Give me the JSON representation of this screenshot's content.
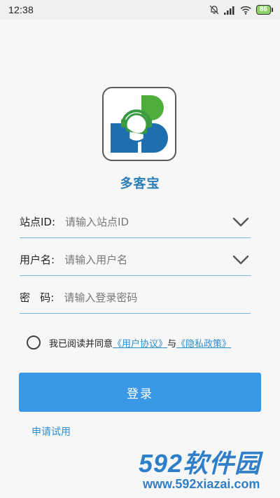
{
  "status_bar": {
    "time": "12:38",
    "battery": "86",
    "icons": [
      "mute-icon",
      "signal-icon",
      "wifi-icon",
      "battery-icon"
    ]
  },
  "app": {
    "name": "多客宝",
    "logo_icon": "duokebao-logo-icon",
    "brand_color": "#2b7fb6"
  },
  "form": {
    "station": {
      "label": "站点ID:",
      "placeholder": "请输入站点ID",
      "value": ""
    },
    "username": {
      "label": "用户名:",
      "placeholder": "请输入用户名",
      "value": ""
    },
    "password": {
      "label": "密   码:",
      "placeholder": "请输入登录密码",
      "value": ""
    }
  },
  "agreement": {
    "checked": false,
    "prefix": "我已阅读并同意",
    "user_agreement": "《用户协议》",
    "conjunction": "与",
    "privacy_policy": "《隐私政策》"
  },
  "login_button": {
    "label": "登录",
    "color": "#3a98e6"
  },
  "trial_link": {
    "label": "申请试用"
  },
  "watermark": {
    "brand": "592软件园",
    "url": "www.592xiazai.com"
  }
}
